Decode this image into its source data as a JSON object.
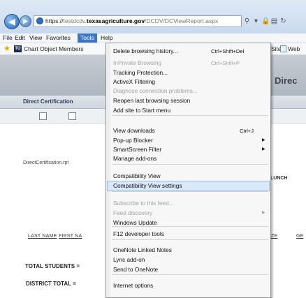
{
  "browser": {
    "address_bar": {
      "protocol": "https://",
      "subdomain": "testdcdv.",
      "host": "texasagriculture.gov",
      "path": "/DCDV/DCViewReport.aspx"
    },
    "address_tools_icons": [
      "search-icon",
      "lock-icon",
      "refresh-icon"
    ],
    "menubar": [
      "File",
      "Edit",
      "View",
      "Favorites",
      "Tools",
      "Help"
    ],
    "favorites_bar": {
      "item1": "Chart Object Members",
      "item2": "Sites",
      "item3": "Web"
    }
  },
  "page": {
    "title": "Direc",
    "section_title": "Direct Certification",
    "report": {
      "filename": "DirectCertification.rpt",
      "lunch_label": "LUNCH",
      "col_last_name": "LAST NAME",
      "col_first_name": "FIRST NA",
      "col_partial": "ZE",
      "col_partial2": "GE",
      "total_students": "TOTAL STUDENTS =",
      "district_total": "DISTRICT TOTAL ="
    }
  },
  "tools_menu": {
    "items": [
      {
        "label": "Delete browsing history...",
        "shortcut": "Ctrl+Shift+Del"
      },
      {
        "label": "InPrivate Browsing",
        "shortcut": "Ctrl+Shift+P",
        "disabled": true
      },
      {
        "label": "Tracking Protection..."
      },
      {
        "label": "ActiveX Filtering"
      },
      {
        "label": "Diagnose connection problems...",
        "disabled": true
      },
      {
        "label": "Reopen last browsing session"
      },
      {
        "label": "Add site to Start menu"
      },
      {
        "label": "View downloads",
        "shortcut": "Ctrl+J"
      },
      {
        "label": "Pop-up Blocker",
        "submenu": true
      },
      {
        "label": "SmartScreen Filter",
        "submenu": true
      },
      {
        "label": "Manage add-ons"
      },
      {
        "label": "Compatibility View"
      },
      {
        "label": "Compatibility View settings",
        "highlighted": true
      },
      {
        "label": "Subscribe to this feed...",
        "disabled": true
      },
      {
        "label": "Feed discovery",
        "submenu": true,
        "disabled": true
      },
      {
        "label": "Windows Update"
      },
      {
        "label": "F12 developer tools"
      },
      {
        "label": "OneNote Linked Notes"
      },
      {
        "label": "Lync add-on"
      },
      {
        "label": "Send to OneNote"
      },
      {
        "label": "Internet options"
      }
    ]
  }
}
